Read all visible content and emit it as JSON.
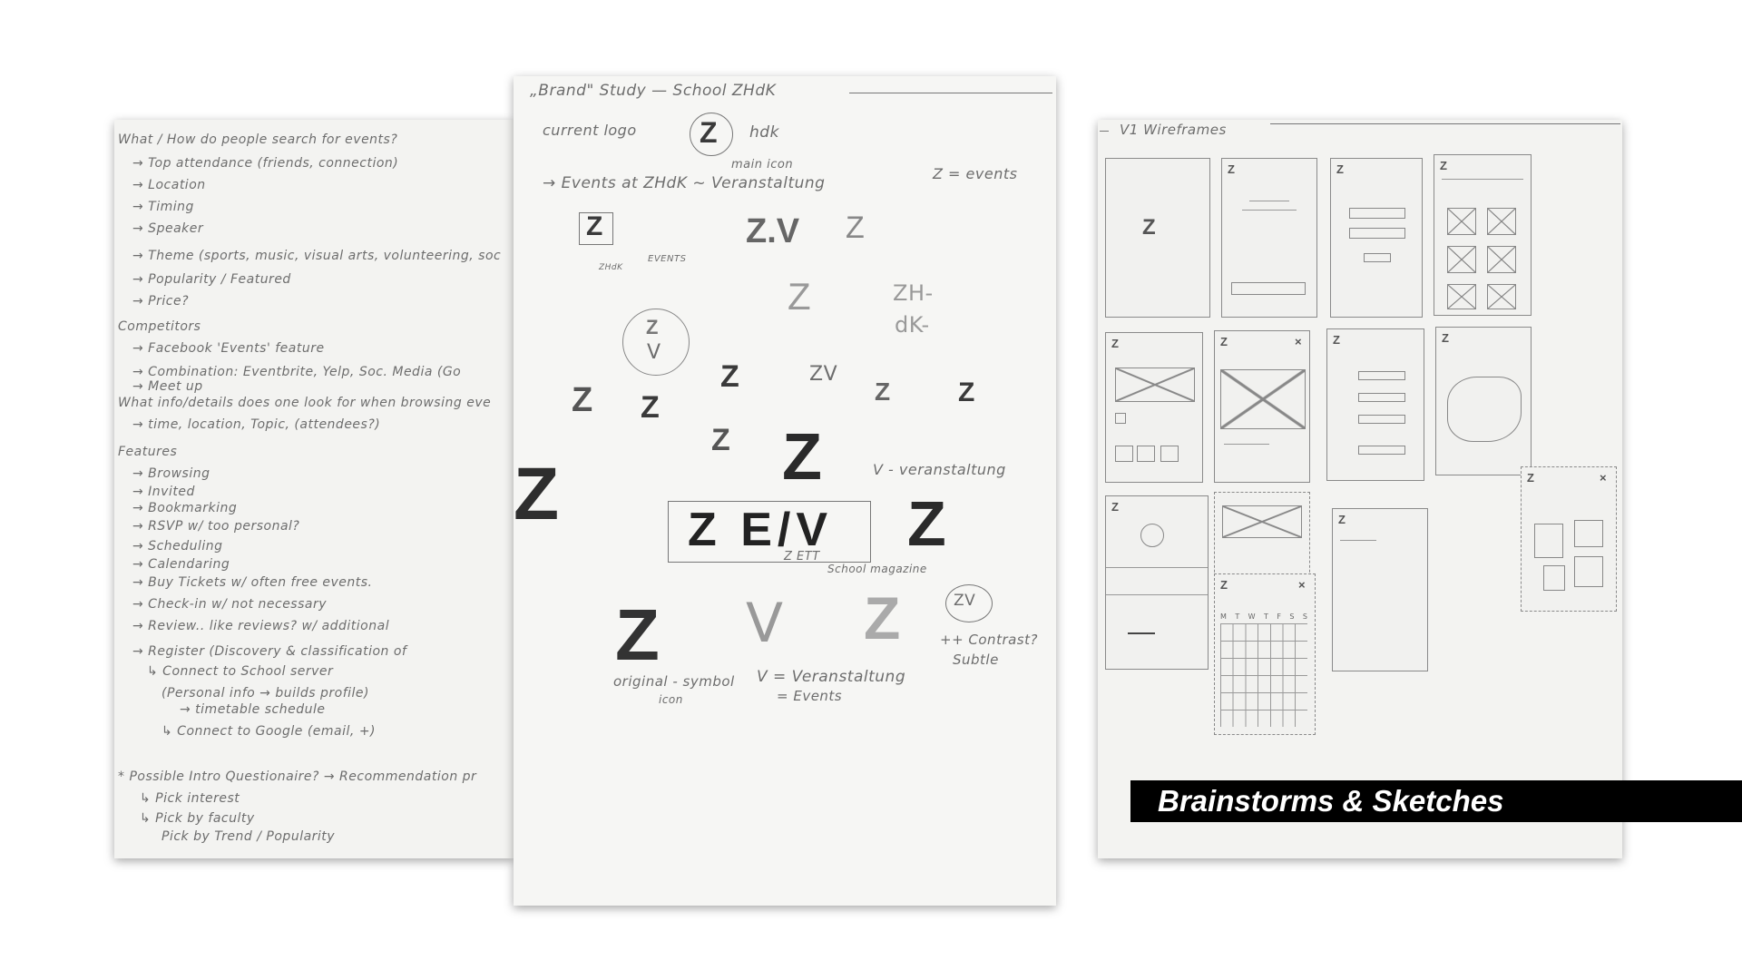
{
  "caption": "Brainstorms & Sketches",
  "left_sheet": {
    "lines": [
      "What / How do people search for events?",
      "→ Top attendance (friends, connection)",
      "→ Location",
      "→ Timing",
      "→ Speaker",
      "→ Theme (sports, music, visual arts, volunteering, soc",
      "→ Popularity / Featured",
      "→ Price?",
      "Competitors",
      "→ Facebook 'Events' feature",
      "→ Combination: Eventbrite, Yelp, Soc. Media (Go",
      "→ Meet up",
      "What info/details does one look for when browsing eve",
      "→ time, location, Topic, (attendees?)",
      "Features",
      "→ Browsing",
      "→ Invited",
      "→ Bookmarking",
      "→ RSVP w/ too personal?",
      "→ Scheduling",
      "→ Calendaring",
      "→ Buy Tickets w/ often free events.",
      "→ Check-in w/ not necessary",
      "→ Review.. like reviews? w/ additional",
      "→ Register (Discovery & classification of",
      "↳ Connect to School server",
      "(Personal info → builds profile)",
      "→ timetable schedule",
      "↳ Connect to Google (email, +)",
      "* Possible Intro Questionaire? → Recommendation pr",
      "↳ Pick interest",
      "↳ Pick by faculty",
      "Pick by Trend / Popularity"
    ]
  },
  "mid_sheet": {
    "title": "„Brand\" Study — School ZHdK",
    "current_logo": "current logo",
    "logo_z": "Z",
    "logo_hdk": "hdk",
    "main_icon": "main icon",
    "events_line": "→ Events at ZHdK ~ Veranstaltung",
    "z_events": "Z = events",
    "zhdk_small": "ZHdK",
    "events_small": "EVENTS",
    "zv_1": "Z.V",
    "zh_dk": "ZH-",
    "dk": "dK-",
    "circle_z": "Z",
    "circle_v": "V",
    "zv_2": "ZV",
    "v_veranstaltung": "V - veranstaltung",
    "zev": "Z E/V",
    "big_z": "Z",
    "z_ett": "Z ETT",
    "school_magazine": "School magazine",
    "original_symbol": "original - symbol",
    "icon": "icon",
    "v_def": "V = Veranstaltung",
    "v_events": "= Events",
    "zv_circle": "ZV",
    "contrast": "++ Contrast?",
    "subtle": "Subtle",
    "v_letter": "V"
  },
  "right_sheet": {
    "title": "V1 Wireframes",
    "z": "Z",
    "close": "×",
    "calendar_days": [
      "M",
      "T",
      "W",
      "T",
      "F",
      "S",
      "S"
    ]
  }
}
